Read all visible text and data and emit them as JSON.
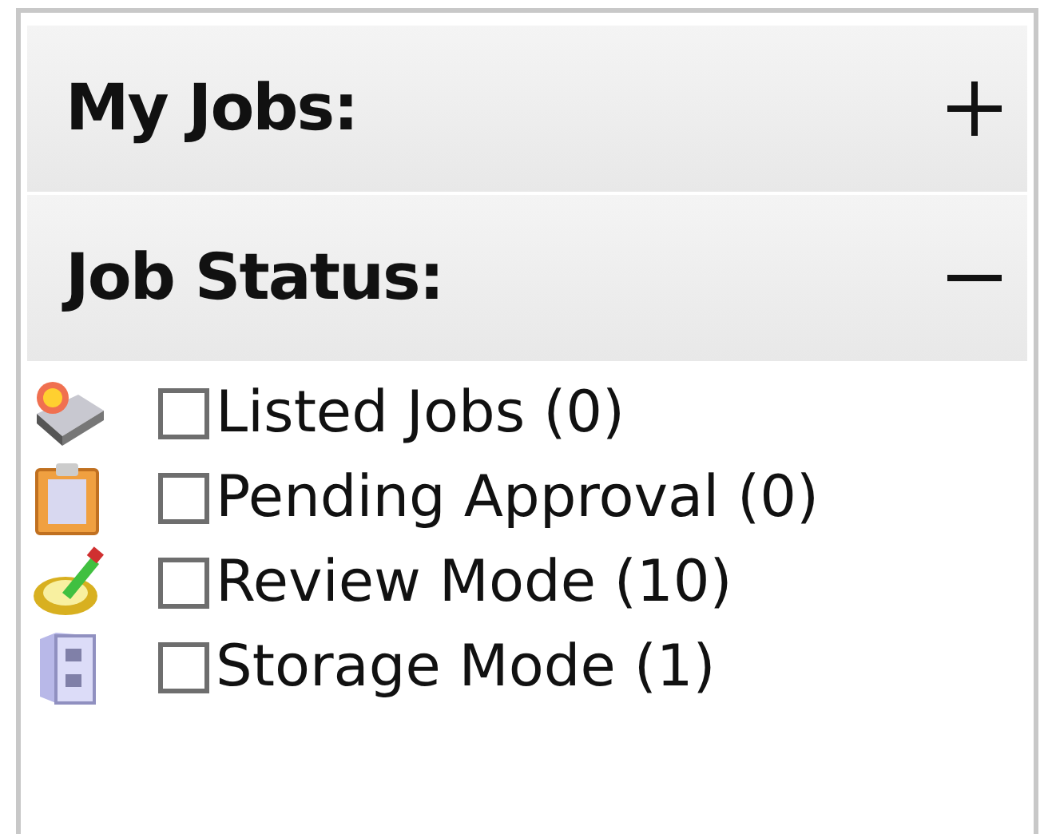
{
  "sections": [
    {
      "title": "My Jobs:",
      "expanded": false
    },
    {
      "title": "Job Status:",
      "expanded": true,
      "items": [
        {
          "kind": "listed",
          "label": "Listed Jobs (0)",
          "checked": false
        },
        {
          "kind": "pending",
          "label": "Pending Approval (0)",
          "checked": false
        },
        {
          "kind": "review",
          "label": "Review Mode (10)",
          "checked": false
        },
        {
          "kind": "storage",
          "label": "Storage Mode (1)",
          "checked": false
        }
      ]
    }
  ]
}
